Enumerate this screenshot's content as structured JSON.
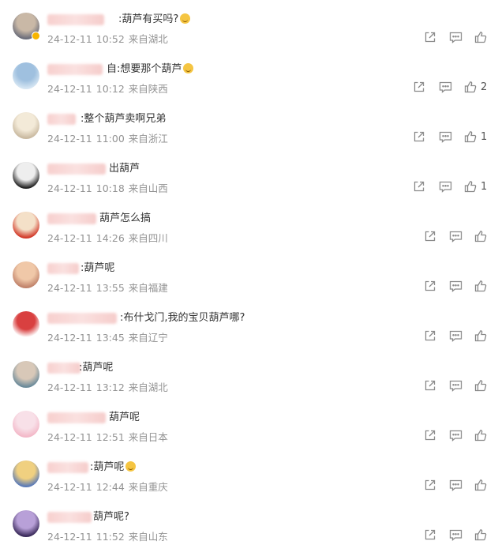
{
  "colors": {
    "text": "#333333",
    "meta": "#939393",
    "icon": "#8a8a8a",
    "name_blur": "#f6c8c6"
  },
  "icons": {
    "share": "share-icon",
    "comment": "comment-icon",
    "like": "like-icon"
  },
  "comments": [
    {
      "content": ":葫芦有买吗?",
      "date": "24-12-11",
      "time": "10:52",
      "location": "来自湖北",
      "likes": "",
      "emoji": "emoji-icon"
    },
    {
      "content": "自:想要那个葫芦",
      "date": "24-12-11",
      "time": "10:12",
      "location": "来自陕西",
      "likes": "2",
      "emoji": "emoji-icon"
    },
    {
      "content": ":整个葫芦卖啊兄弟",
      "date": "24-12-11",
      "time": "11:00",
      "location": "来自浙江",
      "likes": "1"
    },
    {
      "content": "出葫芦",
      "date": "24-12-11",
      "time": "10:18",
      "location": "来自山西",
      "likes": "1"
    },
    {
      "content": "葫芦怎么搞",
      "date": "24-12-11",
      "time": "14:26",
      "location": "来自四川",
      "likes": ""
    },
    {
      "content": ":葫芦呢",
      "date": "24-12-11",
      "time": "13:55",
      "location": "来自福建",
      "likes": ""
    },
    {
      "content": ":布什戈门,我的宝贝葫芦哪?",
      "date": "24-12-11",
      "time": "13:45",
      "location": "来自辽宁",
      "likes": ""
    },
    {
      "content": ":葫芦呢",
      "date": "24-12-11",
      "time": "13:12",
      "location": "来自湖北",
      "likes": ""
    },
    {
      "content": "葫芦呢",
      "date": "24-12-11",
      "time": "12:51",
      "location": "来自日本",
      "likes": ""
    },
    {
      "content": ":葫芦呢",
      "date": "24-12-11",
      "time": "12:44",
      "location": "来自重庆",
      "likes": "",
      "emoji": "emoji-icon"
    },
    {
      "content": "葫芦呢?",
      "date": "24-12-11",
      "time": "11:52",
      "location": "来自山东",
      "likes": ""
    }
  ]
}
